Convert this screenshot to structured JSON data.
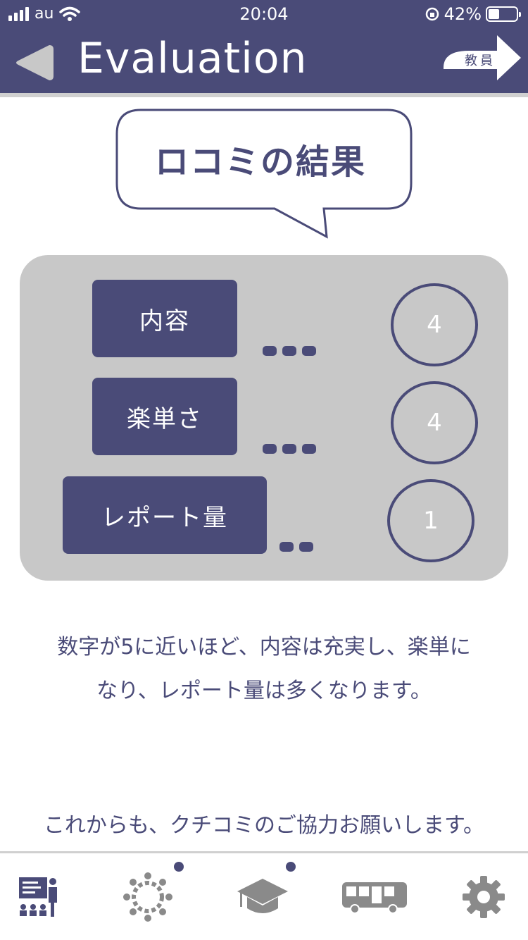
{
  "status_bar": {
    "carrier": "au",
    "time": "20:04",
    "battery": "42%"
  },
  "header": {
    "title": "Evaluation",
    "teacher_button_label": "教員"
  },
  "bubble": {
    "text": "ロコミの結果"
  },
  "results": [
    {
      "label": "内容",
      "score": "4"
    },
    {
      "label": "楽単さ",
      "score": "4"
    },
    {
      "label": "レポート量",
      "score": "1"
    }
  ],
  "description": {
    "line1": "数字が5に近いほど、内容は充実し、楽単に",
    "line2": "なり、レポート量は多くなります。"
  },
  "thanks": "これからも、クチコミのご協力お願いします。",
  "tabs": [
    {
      "icon": "lecture-icon"
    },
    {
      "icon": "community-icon",
      "badge": true
    },
    {
      "icon": "graduation-cap-icon",
      "badge": true
    },
    {
      "icon": "bus-icon"
    },
    {
      "icon": "settings-gear-icon"
    }
  ]
}
